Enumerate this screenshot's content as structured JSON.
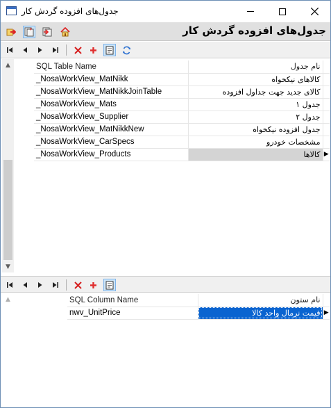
{
  "window": {
    "title": "جدول‌های افزوده گردش کار"
  },
  "header": {
    "title": "جدول‌های افزوده گردش کار",
    "icons": [
      "exit-icon",
      "select-tables-icon",
      "columns-icon",
      "home-icon"
    ]
  },
  "navigator": {
    "buttons": [
      "first-record-icon",
      "prev-record-icon",
      "next-record-icon",
      "last-record-icon",
      "delete-icon",
      "add-icon",
      "edit-icon",
      "refresh-icon"
    ]
  },
  "tables_grid": {
    "columns": {
      "sql": "SQL Table Name",
      "name": "نام جدول"
    },
    "rows": [
      {
        "sql": "_NosaWorkView_MatNikk",
        "name": "کالاهای نیکخواه"
      },
      {
        "sql": "_NosaWorkView_MatNikkJoinTable",
        "name": "کالای جدید جهت جداول افزوده"
      },
      {
        "sql": "_NosaWorkView_Mats",
        "name": "جدول ۱"
      },
      {
        "sql": "_NosaWorkView_Supplier",
        "name": "جدول ۲"
      },
      {
        "sql": "_NosaWorkView_MatNikkNew",
        "name": "جدول افزوده نیکخواه"
      },
      {
        "sql": "_NosaWorkView_CarSpecs",
        "name": "مشخصات خودرو"
      },
      {
        "sql": "_NosaWorkView_Products",
        "name": "کالاها"
      }
    ],
    "selected_row": 6
  },
  "columns_grid": {
    "columns": {
      "sql": "SQL Column Name",
      "name": "نام ستون"
    },
    "rows": [
      {
        "sql": "nwv_UnitPrice",
        "name": "قیمت نرمال واحد کالا"
      }
    ],
    "selected_row": 0
  },
  "colors": {
    "accent": "#0a64d0",
    "header_band": "#e0e0e0",
    "delete_red": "#d62020",
    "add_red": "#e03030",
    "refresh_blue": "#2a6fd0"
  }
}
